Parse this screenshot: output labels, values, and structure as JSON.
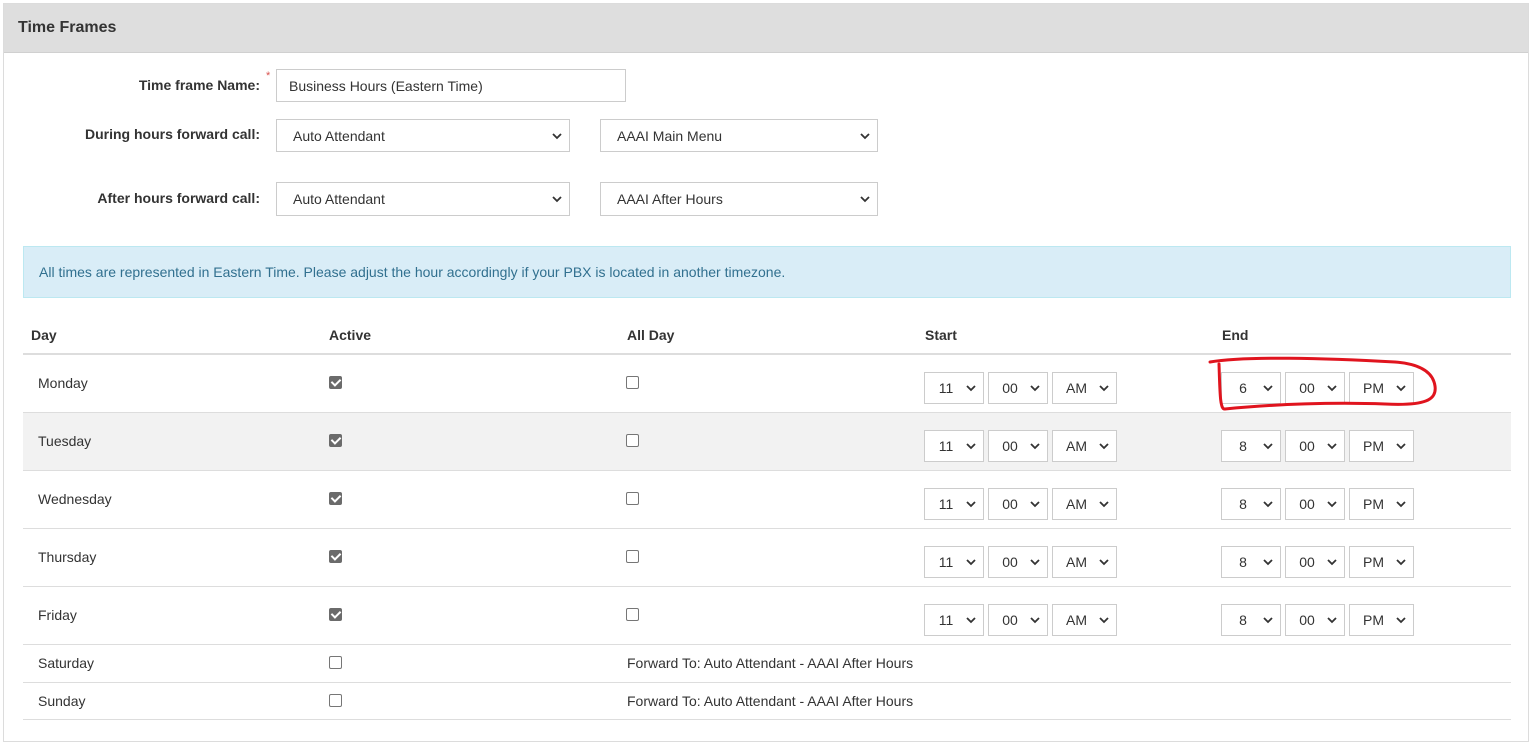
{
  "panel": {
    "title": "Time Frames"
  },
  "form": {
    "name_label": "Time frame Name:",
    "required_mark": "*",
    "name_value": "Business Hours (Eastern Time)",
    "during_label": "During hours forward call:",
    "during_type": "Auto Attendant",
    "during_target": "AAAI Main Menu",
    "after_label": "After hours forward call:",
    "after_type": "Auto Attendant",
    "after_target": "AAAI After Hours"
  },
  "alert": {
    "text": "All times are represented in Eastern Time. Please adjust the hour accordingly if your PBX is located in another timezone."
  },
  "table": {
    "headers": {
      "day": "Day",
      "active": "Active",
      "all_day": "All Day",
      "start": "Start",
      "end": "End"
    },
    "rows": [
      {
        "day": "Monday",
        "active": true,
        "all_day": false,
        "start": {
          "hour": "11",
          "minute": "00",
          "ampm": "AM"
        },
        "end": {
          "hour": "6",
          "minute": "00",
          "ampm": "PM"
        }
      },
      {
        "day": "Tuesday",
        "active": true,
        "all_day": false,
        "start": {
          "hour": "11",
          "minute": "00",
          "ampm": "AM"
        },
        "end": {
          "hour": "8",
          "minute": "00",
          "ampm": "PM"
        }
      },
      {
        "day": "Wednesday",
        "active": true,
        "all_day": false,
        "start": {
          "hour": "11",
          "minute": "00",
          "ampm": "AM"
        },
        "end": {
          "hour": "8",
          "minute": "00",
          "ampm": "PM"
        }
      },
      {
        "day": "Thursday",
        "active": true,
        "all_day": false,
        "start": {
          "hour": "11",
          "minute": "00",
          "ampm": "AM"
        },
        "end": {
          "hour": "8",
          "minute": "00",
          "ampm": "PM"
        }
      },
      {
        "day": "Friday",
        "active": true,
        "all_day": false,
        "start": {
          "hour": "11",
          "minute": "00",
          "ampm": "AM"
        },
        "end": {
          "hour": "8",
          "minute": "00",
          "ampm": "PM"
        }
      },
      {
        "day": "Saturday",
        "active": false,
        "forward": "Forward To: Auto Attendant - AAAI After Hours"
      },
      {
        "day": "Sunday",
        "active": false,
        "forward": "Forward To: Auto Attendant - AAAI After Hours"
      }
    ]
  },
  "colors": {
    "alert_bg": "#d9edf7",
    "alert_text": "#31708f",
    "annotation": "#e0141e",
    "header_bg": "#dedede"
  },
  "icons": {
    "select_arrow": "chevron-down-icon",
    "checkbox": "checkbox-icon"
  }
}
